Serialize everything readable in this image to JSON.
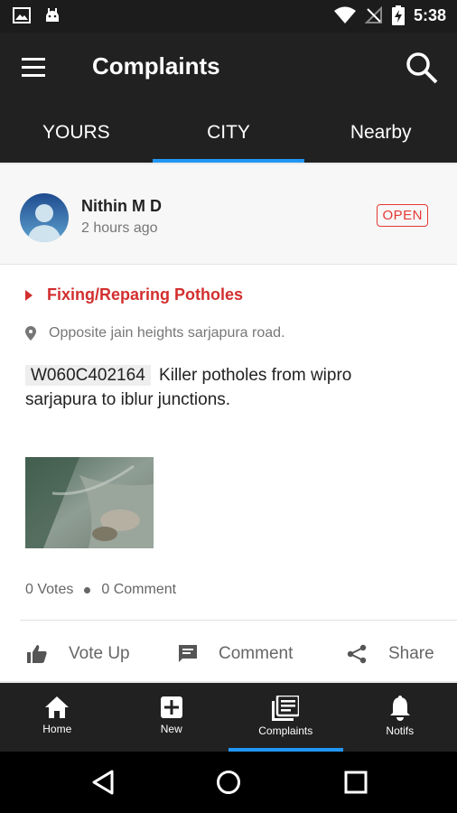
{
  "status_bar": {
    "time": "5:38"
  },
  "app_bar": {
    "title": "Complaints"
  },
  "tabs": [
    {
      "label": "YOURS",
      "active": false
    },
    {
      "label": "CITY",
      "active": true
    },
    {
      "label": "Nearby",
      "active": false
    }
  ],
  "complaint": {
    "user_name": "Nithin M D",
    "time_ago": "2 hours ago",
    "status": "OPEN",
    "category": "Fixing/Reparing Potholes",
    "location": "Opposite jain heights sarjapura road.",
    "code": "W060C402164",
    "description": "Killer potholes from wipro sarjapura to iblur junctions.",
    "votes": "0 Votes",
    "comments": "0 Comment"
  },
  "actions": {
    "vote": "Vote Up",
    "comment": "Comment",
    "share": "Share"
  },
  "bottom_nav": [
    {
      "label": "Home",
      "icon": "home-icon"
    },
    {
      "label": "New",
      "icon": "plus-box-icon"
    },
    {
      "label": "Complaints",
      "icon": "list-icon",
      "active": true
    },
    {
      "label": "Notifs",
      "icon": "bell-icon"
    }
  ],
  "colors": {
    "accent": "#2196f3",
    "status_red": "#e53935",
    "bar_bg": "#212121"
  }
}
